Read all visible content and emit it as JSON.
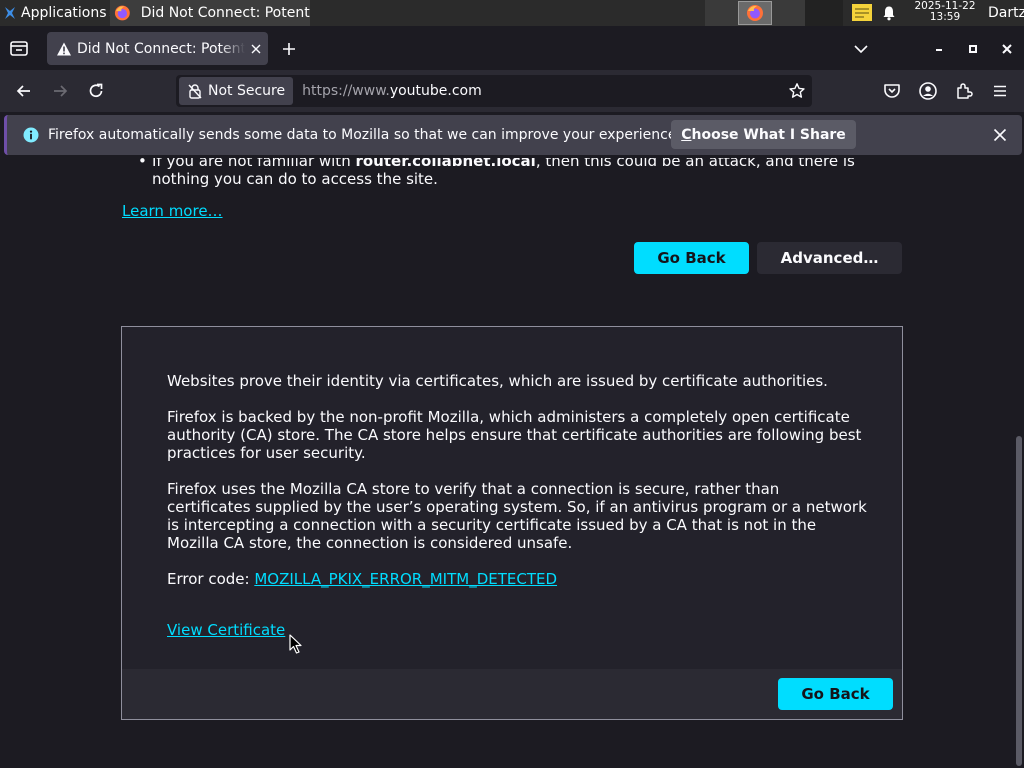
{
  "taskbar": {
    "apps_label": "Applications",
    "apps_sep": "≡",
    "window_title": "Did Not Connect: Potent...",
    "clock_date": "2025-11-22",
    "clock_time": "13:59",
    "user": "Dartz"
  },
  "browser": {
    "tab_title": "Did Not Connect: Potential Security Issue",
    "not_secure_label": "Not Secure",
    "url_prefix": "https://www.",
    "url_host": "youtube.com"
  },
  "notification": {
    "message": "Firefox automatically sends some data to Mozilla so that we can improve your experience.",
    "button_first_letter": "C",
    "button_rest": "hoose What I Share"
  },
  "page": {
    "cut_text_pre": "If you are not familiar with ",
    "cut_text_bold": "router.collabnet.local",
    "cut_text_post": ", then this could be an attack, and there is nothing you can do to access the site.",
    "learn_more": "Learn more…",
    "go_back": "Go Back",
    "advanced": "Advanced…",
    "para1": "Websites prove their identity via certificates, which are issued by certificate authorities.",
    "para2": "Firefox is backed by the non-profit Mozilla, which administers a completely open certificate authority (CA) store. The CA store helps ensure that certificate authorities are following best practices for user security.",
    "para3": "Firefox uses the Mozilla CA store to verify that a connection is secure, rather than certificates supplied by the user’s operating system. So, if an antivirus program or a network is intercepting a connection with a security certificate issued by a CA that is not in the Mozilla CA store, the connection is considered unsafe.",
    "error_code_label": "Error code: ",
    "error_code": "MOZILLA_PKIX_ERROR_MITM_DETECTED",
    "view_certificate": "View Certificate",
    "go_back_panel": "Go Back"
  },
  "icons": {
    "apps": "xfce-menu-icon",
    "firefox": "firefox-icon",
    "warning": "warning-triangle-icon",
    "lock": "insecure-lock-icon",
    "info": "info-icon",
    "star": "bookmark-star-icon"
  },
  "colors": {
    "accent": "#00ddff",
    "page_bg": "#1c1b22",
    "toolbar_bg": "#2b2a33",
    "notification_bar": "#42414d"
  }
}
